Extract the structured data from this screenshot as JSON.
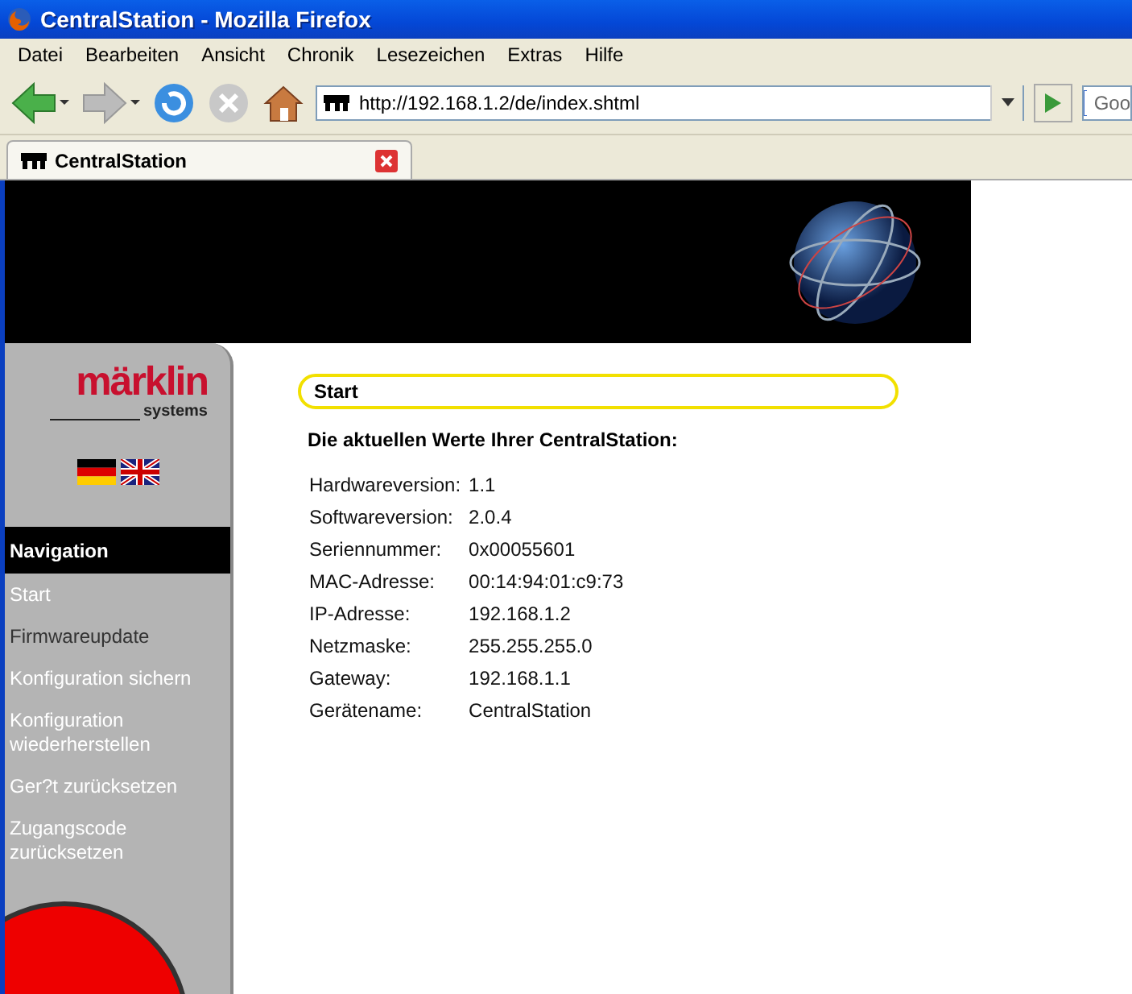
{
  "window": {
    "title": "CentralStation - Mozilla Firefox"
  },
  "menu": [
    "Datei",
    "Bearbeiten",
    "Ansicht",
    "Chronik",
    "Lesezeichen",
    "Extras",
    "Hilfe"
  ],
  "address_bar": {
    "value": "http://192.168.1.2/de/index.shtml"
  },
  "search": {
    "value": "Goo"
  },
  "tabs": [
    {
      "label": "CentralStation",
      "selected": true
    }
  ],
  "logo": {
    "brand": "märklin",
    "sub": "systems"
  },
  "sidebar": {
    "heading": "Navigation",
    "items": [
      {
        "label": "Start",
        "highlighted": false
      },
      {
        "label": "Firmwareupdate",
        "highlighted": true
      },
      {
        "label": "Konfiguration sichern",
        "highlighted": false
      },
      {
        "label": "Konfiguration wiederherstellen",
        "highlighted": false
      },
      {
        "label": "Ger?t zurücksetzen",
        "highlighted": false
      },
      {
        "label": "Zugangscode zurücksetzen",
        "highlighted": false
      }
    ]
  },
  "content": {
    "title": "Start",
    "intro": "Die aktuellen Werte Ihrer CentralStation:",
    "rows": [
      {
        "label": "Hardwareversion:",
        "value": "1.1"
      },
      {
        "label": "Softwareversion:",
        "value": "2.0.4"
      },
      {
        "label": "Seriennummer:",
        "value": "0x00055601"
      },
      {
        "label": "MAC-Adresse:",
        "value": "00:14:94:01:c9:73"
      },
      {
        "label": "IP-Adresse:",
        "value": "192.168.1.2"
      },
      {
        "label": "Netzmaske:",
        "value": "255.255.255.0"
      },
      {
        "label": "Gateway:",
        "value": "192.168.1.1"
      },
      {
        "label": "Gerätename:",
        "value": "CentralStation"
      }
    ]
  }
}
